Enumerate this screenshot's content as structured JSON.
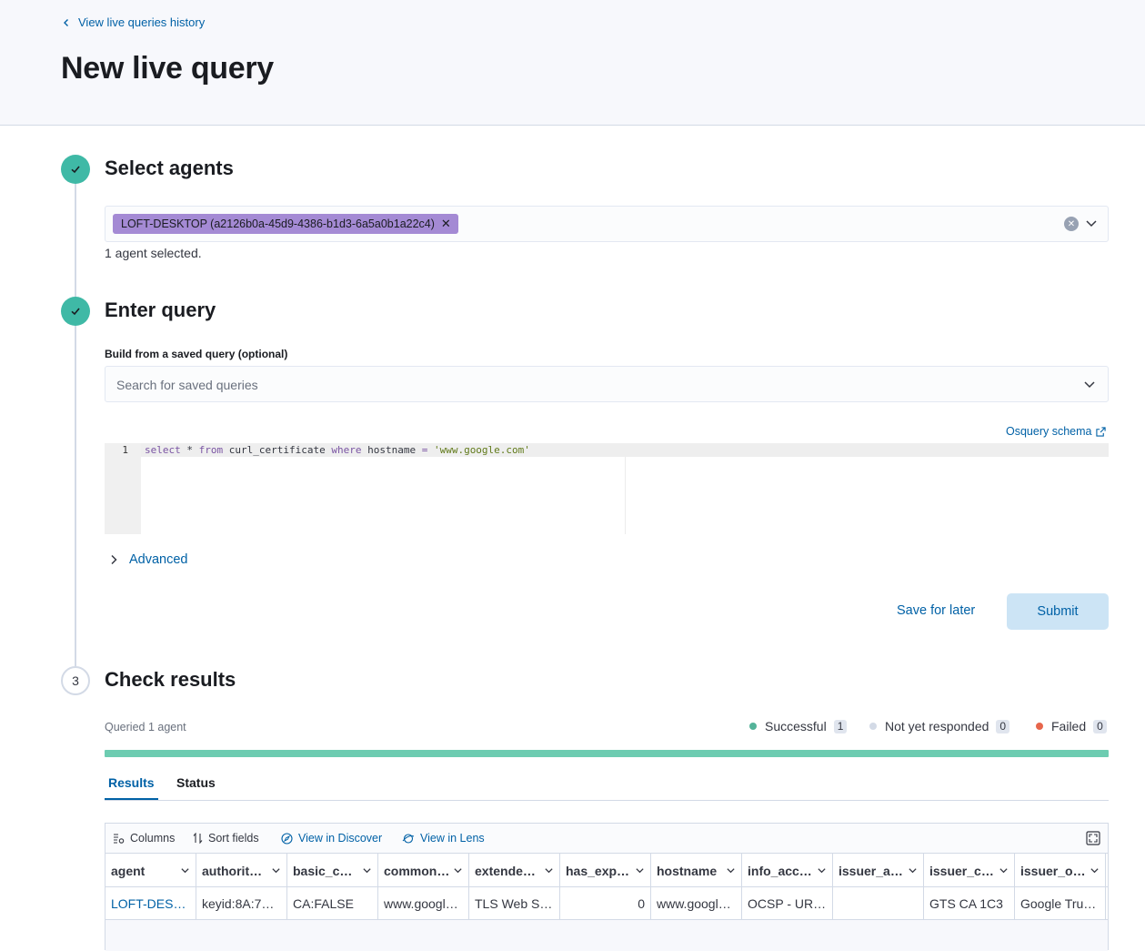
{
  "header": {
    "back_link": "View live queries history",
    "title": "New live query"
  },
  "steps": {
    "select_agents": {
      "title": "Select agents"
    },
    "enter_query": {
      "title": "Enter query"
    },
    "check_results": {
      "number": "3",
      "title": "Check results"
    }
  },
  "agents": {
    "selected_pill": "LOFT-DESKTOP (a2126b0a-45d9-4386-b1d3-6a5a0b1a22c4)",
    "count_text": "1 agent selected."
  },
  "query": {
    "saved_label": "Build from a saved query (optional)",
    "saved_placeholder": "Search for saved queries",
    "schema_link": "Osquery schema",
    "line_number": "1",
    "code": {
      "kw1": "select",
      "t1": " * ",
      "kw2": "from",
      "t2": " curl_certificate ",
      "kw3": "where",
      "t3": " hostname ",
      "op": "=",
      "t4": " ",
      "str": "'www.google.com'"
    },
    "advanced": "Advanced",
    "save_later": "Save for later",
    "submit": "Submit"
  },
  "results": {
    "queried": "Queried 1 agent",
    "successful": {
      "label": "Successful",
      "count": "1",
      "color": "#54b399"
    },
    "not_responded": {
      "label": "Not yet responded",
      "count": "0",
      "color": "#d3dae6"
    },
    "failed": {
      "label": "Failed",
      "count": "0",
      "color": "#e7664c"
    },
    "tabs": {
      "results": "Results",
      "status": "Status"
    },
    "toolbar": {
      "columns": "Columns",
      "sort": "Sort fields",
      "discover": "View in Discover",
      "lens": "View in Lens"
    },
    "columns": [
      "agent",
      "authorit…",
      "basic_c…",
      "common…",
      "extende…",
      "has_exp…",
      "hostname",
      "info_acc…",
      "issuer_a…",
      "issuer_c…",
      "issuer_o…"
    ],
    "row": [
      "LOFT-DES…",
      "keyid:8A:7…",
      "CA:FALSE",
      "www.googl…",
      "TLS Web S…",
      "0",
      "www.googl…",
      "OCSP - UR…",
      "",
      "GTS CA 1C3",
      "Google Tru…"
    ]
  }
}
